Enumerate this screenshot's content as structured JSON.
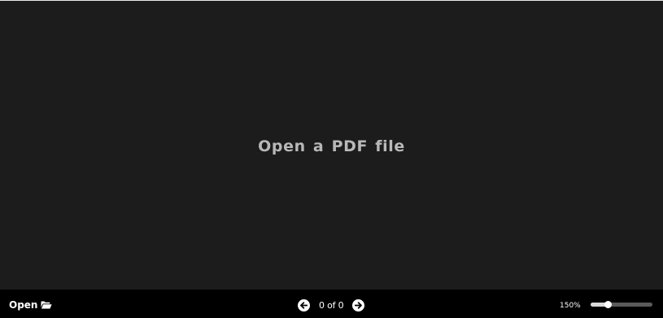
{
  "viewer": {
    "empty_message": "Open a PDF file"
  },
  "toolbar": {
    "open_label": "Open",
    "open_icon": "folder-open-icon",
    "prev_icon": "arrow-left-circle-icon",
    "next_icon": "arrow-right-circle-icon",
    "page_indicator": "0 of 0",
    "zoom_label": "150%",
    "zoom_fraction": 0.28
  },
  "colors": {
    "background": "#1c1c1c",
    "toolbar": "#000000",
    "message": "#b8b8b8",
    "text": "#ffffff"
  }
}
